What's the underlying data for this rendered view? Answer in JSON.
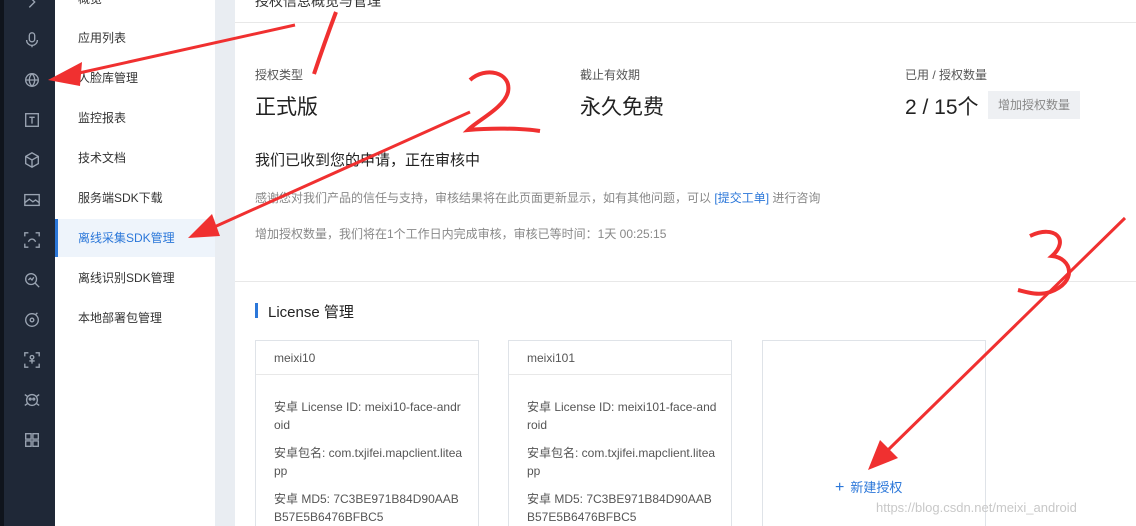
{
  "rail": {
    "icons": [
      "chevron-right-icon",
      "microphone-icon",
      "globe-icon",
      "text-box-icon",
      "cube-icon",
      "image-icon",
      "face-scan-icon",
      "face-search-icon",
      "refresh-target-icon",
      "body-detect-icon",
      "alien-face-icon",
      "apps-grid-icon"
    ]
  },
  "menu": {
    "items": [
      {
        "label": "概览"
      },
      {
        "label": "应用列表"
      },
      {
        "label": "人脸库管理"
      },
      {
        "label": "监控报表"
      },
      {
        "label": "技术文档"
      },
      {
        "label": "服务端SDK下载"
      },
      {
        "label": "离线采集SDK管理"
      },
      {
        "label": "离线识别SDK管理"
      },
      {
        "label": "本地部署包管理"
      }
    ],
    "active_index": 6
  },
  "header": {
    "title": "授权信息概览与管理"
  },
  "stats": {
    "type_label": "授权类型",
    "type_value": "正式版",
    "expiry_label": "截止有效期",
    "expiry_value": "永久免费",
    "count_label": "已用 / 授权数量",
    "count_value": "2 / 15个",
    "increase_button": "增加授权数量"
  },
  "review": {
    "title": "我们已收到您的申请，正在审核中",
    "message_before": "感谢您对我们产品的信任与支持，审核结果将在此页面更新显示，如有其他问题，可以",
    "link": "[提交工单]",
    "message_after": "进行咨询",
    "message2": "增加授权数量，我们将在1个工作日内完成审核，审核已等时间：1天 00:25:15"
  },
  "license": {
    "title": "License 管理",
    "cards": [
      {
        "name": "meixi10",
        "license_id": "安卓 License ID: meixi10-face-android",
        "package": "安卓包名: com.txjifei.mapclient.liteapp",
        "md5": "安卓 MD5: 7C3BE971B84D90AABB57E5B6476BFBC5"
      },
      {
        "name": "meixi101",
        "license_id": "安卓 License ID: meixi101-face-android",
        "package": "安卓包名: com.txjifei.mapclient.liteapp",
        "md5": "安卓 MD5: 7C3BE971B84D90AABB57E5B6476BFBC5"
      }
    ],
    "new_button": "新建授权"
  },
  "annotations": {
    "num1": "1",
    "num2": "2",
    "num3": "3",
    "color": "#f03030"
  },
  "watermark": "https://blog.csdn.net/meixi_android"
}
